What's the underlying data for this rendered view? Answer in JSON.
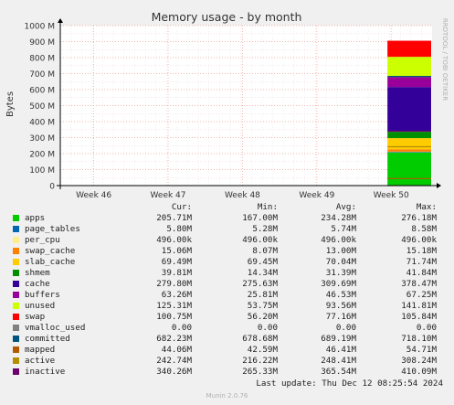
{
  "chart_data": {
    "type": "area",
    "title": "Memory usage - by month",
    "ylabel": "Bytes",
    "xlabel": "",
    "side_label": "RRDTOOL / TOBI OETIKER",
    "ylim": [
      0,
      1000
    ],
    "y_unit": "M",
    "y_ticks": [
      {
        "value": 0,
        "label": "0"
      },
      {
        "value": 100,
        "label": "100 M"
      },
      {
        "value": 200,
        "label": "200 M"
      },
      {
        "value": 300,
        "label": "300 M"
      },
      {
        "value": 400,
        "label": "400 M"
      },
      {
        "value": 500,
        "label": "500 M"
      },
      {
        "value": 600,
        "label": "600 M"
      },
      {
        "value": 700,
        "label": "700 M"
      },
      {
        "value": 800,
        "label": "800 M"
      },
      {
        "value": 900,
        "label": "900 M"
      },
      {
        "value": 1000,
        "label": "1000 M"
      }
    ],
    "x_ticks": [
      {
        "value": 46,
        "label": "Week 46"
      },
      {
        "value": 47,
        "label": "Week 47"
      },
      {
        "value": 48,
        "label": "Week 48"
      },
      {
        "value": 49,
        "label": "Week 49"
      },
      {
        "value": 50,
        "label": "Week 50"
      }
    ],
    "xlim": [
      45.55,
      50.55
    ],
    "data_start_week": 49.95,
    "grid": true,
    "columns": [
      "Cur:",
      "Min:",
      "Avg:",
      "Max:"
    ],
    "series": [
      {
        "name": "apps",
        "color": "#00cc00",
        "stacked": true,
        "cur": "205.71M",
        "min": "167.00M",
        "avg": "234.28M",
        "max": "276.18M",
        "value": 205.71
      },
      {
        "name": "page_tables",
        "color": "#0066b3",
        "stacked": true,
        "cur": "5.80M",
        "min": "5.28M",
        "avg": "5.74M",
        "max": "8.58M",
        "value": 5.8
      },
      {
        "name": "per_cpu",
        "color": "#ffec8b",
        "stacked": true,
        "cur": "496.00k",
        "min": "496.00k",
        "avg": "496.00k",
        "max": "496.00k",
        "value": 0.496
      },
      {
        "name": "swap_cache",
        "color": "#ff8000",
        "stacked": true,
        "cur": "15.06M",
        "min": "8.07M",
        "avg": "13.00M",
        "max": "15.18M",
        "value": 15.06
      },
      {
        "name": "slab_cache",
        "color": "#ffcc00",
        "stacked": true,
        "cur": "69.49M",
        "min": "69.45M",
        "avg": "70.04M",
        "max": "71.74M",
        "value": 69.49
      },
      {
        "name": "shmem",
        "color": "#008f00",
        "stacked": true,
        "cur": "39.81M",
        "min": "14.34M",
        "avg": "31.39M",
        "max": "41.84M",
        "value": 39.81
      },
      {
        "name": "cache",
        "color": "#330099",
        "stacked": true,
        "cur": "279.80M",
        "min": "275.63M",
        "avg": "309.69M",
        "max": "378.47M",
        "value": 279.8
      },
      {
        "name": "buffers",
        "color": "#990099",
        "stacked": true,
        "cur": "63.26M",
        "min": "25.81M",
        "avg": "46.53M",
        "max": "67.25M",
        "value": 63.26
      },
      {
        "name": "unused",
        "color": "#ccff00",
        "stacked": true,
        "cur": "125.31M",
        "min": "53.75M",
        "avg": "93.56M",
        "max": "141.81M",
        "value": 125.31
      },
      {
        "name": "swap",
        "color": "#ff0000",
        "stacked": true,
        "cur": "100.75M",
        "min": "56.20M",
        "avg": "77.16M",
        "max": "105.84M",
        "value": 100.75
      },
      {
        "name": "vmalloc_used",
        "color": "#808080",
        "stacked": false,
        "cur": "0.00",
        "min": "0.00",
        "avg": "0.00",
        "max": "0.00",
        "value": 0
      },
      {
        "name": "committed",
        "color": "#005580",
        "stacked": false,
        "cur": "682.23M",
        "min": "678.68M",
        "avg": "689.19M",
        "max": "718.10M",
        "value": 682.23
      },
      {
        "name": "mapped",
        "color": "#b35a00",
        "stacked": false,
        "cur": "44.06M",
        "min": "42.59M",
        "avg": "46.41M",
        "max": "54.71M",
        "value": 44.06
      },
      {
        "name": "active",
        "color": "#b38f00",
        "stacked": false,
        "cur": "242.74M",
        "min": "216.22M",
        "avg": "248.41M",
        "max": "308.24M",
        "value": 242.74
      },
      {
        "name": "inactive",
        "color": "#6b006b",
        "stacked": false,
        "cur": "340.26M",
        "min": "265.33M",
        "avg": "365.54M",
        "max": "410.09M",
        "value": 340.26
      }
    ]
  },
  "last_update": "Last update: Thu Dec 12 08:25:54 2024",
  "footer": "Munin 2.0.76"
}
